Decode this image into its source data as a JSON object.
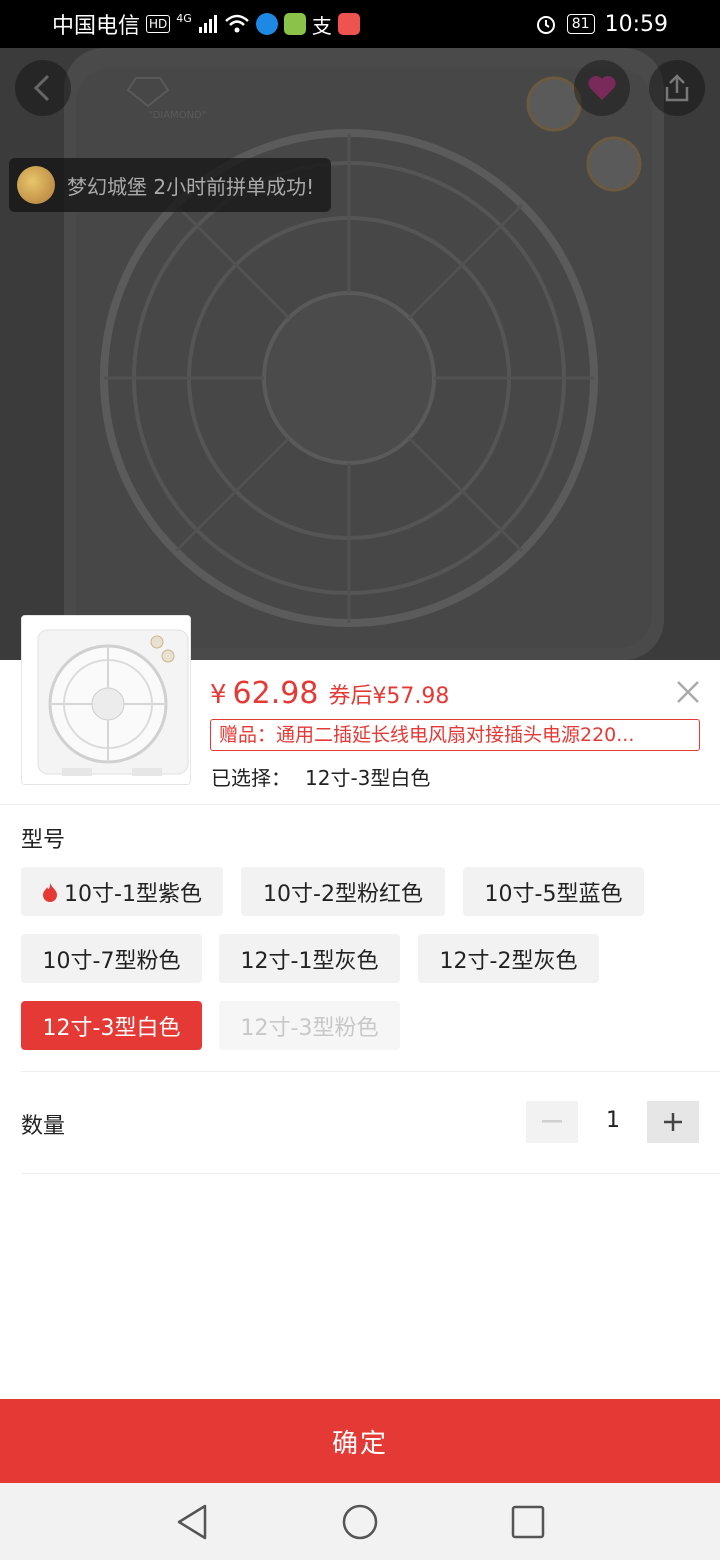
{
  "status_bar": {
    "carrier": "中国电信",
    "network": "4G",
    "hd_badge": "HD",
    "battery": "81",
    "time": "10:59"
  },
  "hero": {
    "toast_text": "梦幻城堡 2小时前拼单成功!",
    "brand_logo_text": "\"DIAMOND\""
  },
  "product": {
    "currency": "¥",
    "price": "62.98",
    "coupon_price": "券后¥57.98",
    "gift": "赠品：通用二插延长线电风扇对接插头电源220...",
    "selected_label": "已选择：",
    "selected_value": "12寸-3型白色"
  },
  "options": {
    "title": "型号",
    "items": [
      {
        "label": "10寸-1型紫色",
        "state": "hot"
      },
      {
        "label": "10寸-2型粉红色",
        "state": "normal"
      },
      {
        "label": "10寸-5型蓝色",
        "state": "normal"
      },
      {
        "label": "10寸-7型粉色",
        "state": "normal"
      },
      {
        "label": "12寸-1型灰色",
        "state": "normal"
      },
      {
        "label": "12寸-2型灰色",
        "state": "normal"
      },
      {
        "label": "12寸-3型白色",
        "state": "selected"
      },
      {
        "label": "12寸-3型粉色",
        "state": "disabled"
      }
    ]
  },
  "quantity": {
    "label": "数量",
    "value": "1",
    "minus_label": "−",
    "plus_label": "+"
  },
  "confirm_label": "确定",
  "colors": {
    "accent": "#e53935",
    "option_bg": "#f2f2f2"
  },
  "icons": [
    "back-icon",
    "favorite-icon",
    "share-icon",
    "close-icon",
    "flame-icon",
    "nav-back-icon",
    "nav-home-icon",
    "nav-recents-icon"
  ]
}
